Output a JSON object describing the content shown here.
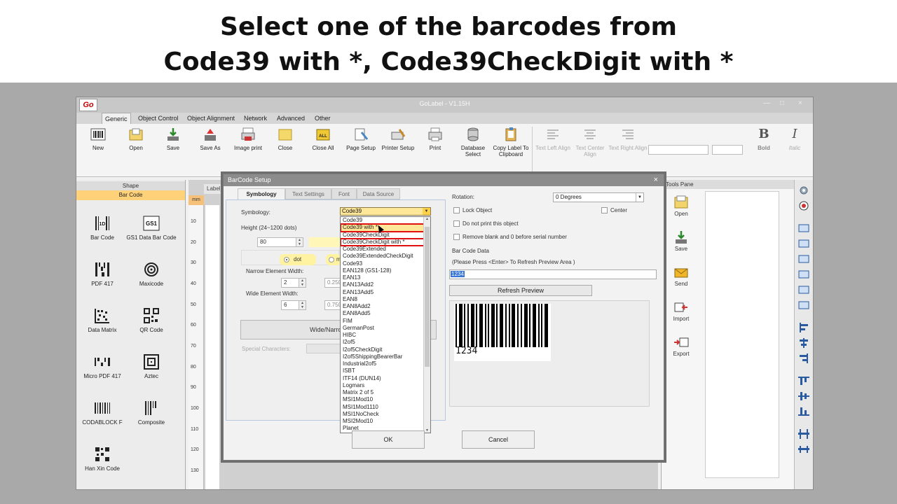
{
  "caption": {
    "line1": "Select one of the barcodes from",
    "line2": "Code39 with *, Code39CheckDigit with *"
  },
  "app": {
    "title": "GoLabel - V1.15H",
    "logo": "Go",
    "menu_tabs": [
      "Generic",
      "Object Control",
      "Object Alignment",
      "Network",
      "Advanced",
      "Other"
    ],
    "ribbon": [
      {
        "label": "New",
        "icon": "barcode-icon"
      },
      {
        "label": "Open",
        "icon": "open-icon"
      },
      {
        "label": "Save",
        "icon": "save-icon"
      },
      {
        "label": "Save As",
        "icon": "save-as-icon"
      },
      {
        "label": "Image print",
        "icon": "image-print-icon"
      },
      {
        "label": "Close",
        "icon": "close-folder-icon"
      },
      {
        "label": "Close All",
        "icon": "close-all-icon"
      },
      {
        "label": "Page Setup",
        "icon": "page-setup-icon"
      },
      {
        "label": "Printer Setup",
        "icon": "printer-setup-icon"
      },
      {
        "label": "Print",
        "icon": "print-icon"
      },
      {
        "label": "Database Select",
        "icon": "database-icon"
      },
      {
        "label": "Copy Label To Clipboard",
        "icon": "clipboard-icon"
      }
    ],
    "format_buttons": [
      {
        "label": "Text Left Align"
      },
      {
        "label": "Text Center Align"
      },
      {
        "label": "Text Right Align"
      }
    ],
    "bold_label": "Bold",
    "italic_label": "Italic",
    "bold_glyph": "B",
    "italic_glyph": "I"
  },
  "left_panel": {
    "header": "Shape",
    "section": "Bar Code",
    "items": [
      {
        "label": "Bar Code",
        "icon": "1d-barcode-icon",
        "glyph": "1D"
      },
      {
        "label": "GS1 Data Bar Code",
        "icon": "gs1-icon",
        "glyph": "GS1"
      },
      {
        "label": "PDF 417",
        "icon": "pdf417-icon"
      },
      {
        "label": "Maxicode",
        "icon": "maxicode-icon"
      },
      {
        "label": "Data Matrix",
        "icon": "datamatrix-icon"
      },
      {
        "label": "QR Code",
        "icon": "qrcode-icon"
      },
      {
        "label": "Micro PDF 417",
        "icon": "micro-pdf417-icon"
      },
      {
        "label": "Aztec",
        "icon": "aztec-icon"
      },
      {
        "label": "CODABLOCK F",
        "icon": "codablock-icon"
      },
      {
        "label": "Composite",
        "icon": "composite-icon"
      },
      {
        "label": "Han Xin Code",
        "icon": "hanxin-icon"
      }
    ]
  },
  "canvas": {
    "doc_tab": "Label_0",
    "unit": "mm",
    "ruler_ticks": [
      "10",
      "20",
      "30",
      "40",
      "50",
      "60",
      "70",
      "80",
      "90",
      "100",
      "110",
      "120",
      "130"
    ]
  },
  "tools_pane": {
    "title": "Tools Pane",
    "items": [
      "Open",
      "Save",
      "Send",
      "Import",
      "Export"
    ]
  },
  "dialog": {
    "title": "BarCode Setup",
    "close_glyph": "×",
    "tabs": [
      "Symbology",
      "Text Settings",
      "Font",
      "Data Source"
    ],
    "symbology_label": "Symbology:",
    "symbology_value": "Code39",
    "height_label": "Height (24~1200 dots)",
    "height_value": "80",
    "unit_dot": "dot",
    "unit_mm": "mm",
    "narrow_label": "Narrow Element Width:",
    "narrow_value": "2",
    "narrow_mm": "0.250",
    "wide_label": "Wide Element Width:",
    "wide_value": "6",
    "wide_mm": "0.750",
    "ratio_button": "Wide/Narrow",
    "special_label": "Special Characters:",
    "symbology_options": [
      "Code39",
      "Code39 with *",
      "Code39CheckDigit",
      "Code39CheckDigit with *",
      "Code39Extended",
      "Code39ExtendedCheckDigit",
      "Code93",
      "EAN128 (GS1-128)",
      "EAN13",
      "EAN13Add2",
      "EAN13Add5",
      "EAN8",
      "EAN8Add2",
      "EAN8Add5",
      "FIM",
      "GermanPost",
      "HIBC",
      "I2of5",
      "I2of5CheckDigit",
      "I2of5ShippingBearerBar",
      "Industrial2of5",
      "ISBT",
      "ITF14 (DUN14)",
      "Logmars",
      "Matrix 2 of 5",
      "MSI1Mod10",
      "MSI1Mod1110",
      "MSI1NoCheck",
      "MSI2Mod10",
      "Planet"
    ],
    "highlighted_options": [
      "Code39 with *",
      "Code39CheckDigit with *"
    ],
    "rotation_label": "Rotation:",
    "rotation_value": "0 Degrees",
    "lock_object": "Lock Object",
    "center": "Center",
    "do_not_print": "Do not print this object",
    "remove_blank": "Remove blank and 0 before serial number",
    "data_label": "Bar Code Data",
    "data_hint": "(Please  Press <Enter> To Refresh Preview Area )",
    "data_value": "1234",
    "refresh_button": "Refresh Preview",
    "preview_text": "1234",
    "ok": "OK",
    "cancel": "Cancel"
  }
}
